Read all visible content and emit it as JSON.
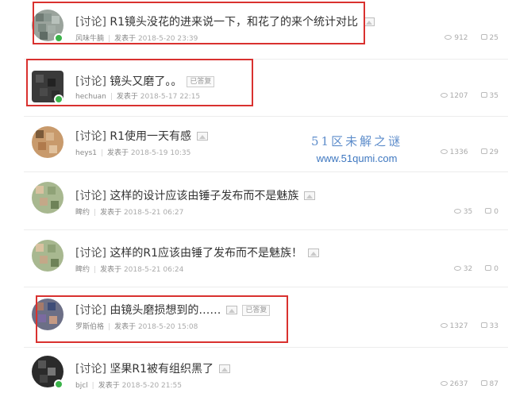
{
  "posts": [
    {
      "tag": "[讨论]",
      "title": "R1镜头没花的进来说一下，和花了的来个统计对比",
      "author": "风味牛腩",
      "posted_label": "发表于",
      "date": "2018-5-20 23:39",
      "views": "912",
      "replies": "25",
      "has_image": true,
      "solved_badge": "",
      "highlighted": true,
      "avatar_icon": "user-avatar-icon"
    },
    {
      "tag": "[讨论]",
      "title": "镜头又磨了。。",
      "author": "hechuan",
      "posted_label": "发表于",
      "date": "2018-5-17 22:15",
      "views": "1207",
      "replies": "35",
      "has_image": false,
      "solved_badge": "已答复",
      "highlighted": true,
      "avatar_icon": "user-avatar-icon"
    },
    {
      "tag": "[讨论]",
      "title": "R1使用一天有感",
      "author": "heys1",
      "posted_label": "发表于",
      "date": "2018-5-19 10:35",
      "views": "1336",
      "replies": "29",
      "has_image": true,
      "solved_badge": "",
      "highlighted": false,
      "avatar_icon": "user-avatar-icon"
    },
    {
      "tag": "[讨论]",
      "title": "这样的设计应该由锤子发布而不是魅族",
      "author": "睥约",
      "posted_label": "发表于",
      "date": "2018-5-21 06:27",
      "views": "35",
      "replies": "0",
      "has_image": true,
      "solved_badge": "",
      "highlighted": false,
      "avatar_icon": "user-avatar-icon"
    },
    {
      "tag": "[讨论]",
      "title": "这样的R1应该由锤了发布而不是魅族！",
      "author": "睥约",
      "posted_label": "发表于",
      "date": "2018-5-21 06:24",
      "views": "32",
      "replies": "0",
      "has_image": true,
      "solved_badge": "",
      "highlighted": false,
      "avatar_icon": "user-avatar-icon"
    },
    {
      "tag": "[讨论]",
      "title": "由镜头磨损想到的……",
      "author": "罗斯伯格",
      "posted_label": "发表于",
      "date": "2018-5-20 15:08",
      "views": "1327",
      "replies": "33",
      "has_image": true,
      "solved_badge": "已答复",
      "highlighted": true,
      "avatar_icon": "user-avatar-icon"
    },
    {
      "tag": "[讨论]",
      "title": "坚果R1被有组织黑了",
      "author": "bjcl",
      "posted_label": "发表于",
      "date": "2018-5-20 21:55",
      "views": "2637",
      "replies": "87",
      "has_image": true,
      "solved_badge": "",
      "highlighted": false,
      "avatar_icon": "user-avatar-icon"
    }
  ],
  "watermark": {
    "site_name": "51区未解之谜",
    "url": "www.51qumi.com"
  },
  "colors": {
    "highlight": "#d9312f",
    "watermark": "#4a7ec4",
    "online_dot": "#3bb34a"
  },
  "icons": {
    "views": "eye-icon",
    "replies": "comment-icon",
    "image": "image-attachment-icon"
  }
}
